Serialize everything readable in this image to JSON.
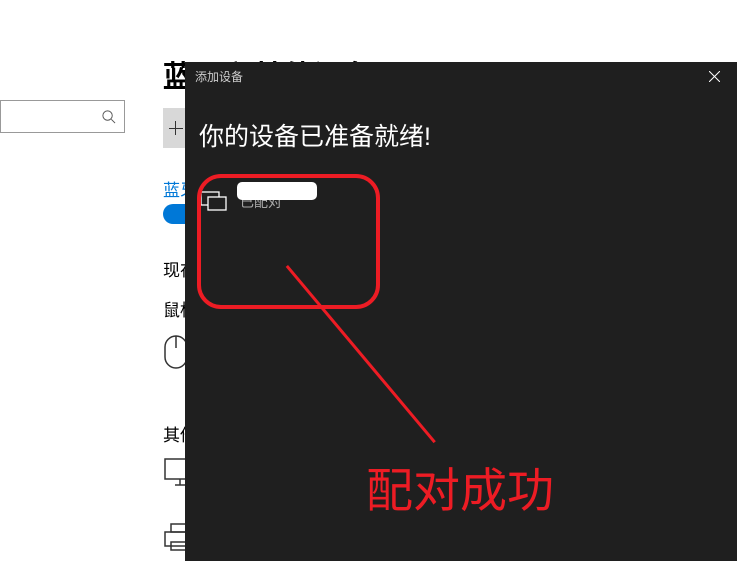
{
  "background": {
    "page_title": "蓝牙和其他设备",
    "bt_toggle_label": "蓝牙",
    "section_now": "现在",
    "section_mouse": "鼠标",
    "section_other": "其他"
  },
  "dialog": {
    "title": "添加设备",
    "heading": "你的设备已准备就绪!",
    "device": {
      "status": "已配对"
    }
  },
  "annotation": {
    "text": "配对成功"
  },
  "colors": {
    "annotation": "#ed1c24",
    "accent": "#0078d7",
    "dialog_bg": "#1f1f1f"
  }
}
